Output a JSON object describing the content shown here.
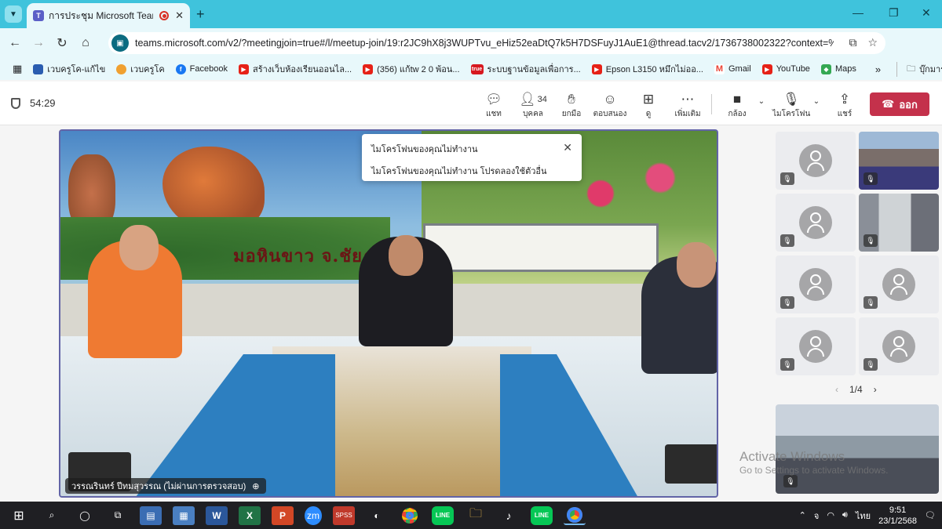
{
  "browser": {
    "tab_title": "การประชุม Microsoft Teams |",
    "tab_app_letter": "T",
    "url": "teams.microsoft.com/v2/?meetingjoin=true#/l/meetup-join/19:r2JC9hX8j3WUPTvu_eHiz52eaDtQ7k5H7DSFuyJ1AuE1@thread.tacv2/1736738002322?context=%7..."
  },
  "bookmarks": [
    {
      "label": "เวบครูโค-แก้ไข",
      "color": "#2a5db0",
      "icon": "bookmark-page-icon"
    },
    {
      "label": "เวบครูโค",
      "color": "#f0a030",
      "icon": "bookmark-globe-icon"
    },
    {
      "label": "Facebook",
      "color": "#1877f2",
      "icon": "facebook-icon"
    },
    {
      "label": "สร้างเว็บห้องเรียนออนไล...",
      "color": "#e62117",
      "icon": "youtube-icon"
    },
    {
      "label": "(356) แก้tw 2 0 พ้อน...",
      "color": "#e62117",
      "icon": "youtube-icon"
    },
    {
      "label": "ระบบฐานข้อมูลเพื่อการ...",
      "color": "#d71920",
      "icon": "true-icon"
    },
    {
      "label": "Epson L3150 หมึกไม่ออ...",
      "color": "#e62117",
      "icon": "youtube-icon"
    },
    {
      "label": "Gmail",
      "color": "#ea4335",
      "icon": "gmail-icon"
    },
    {
      "label": "YouTube",
      "color": "#e62117",
      "icon": "youtube-icon"
    },
    {
      "label": "Maps",
      "color": "#34a853",
      "icon": "maps-icon"
    }
  ],
  "bookmarks_more": "»",
  "bookmarks_all": "บุ๊กมาร์กทั้งหมด",
  "meeting": {
    "elapsed": "54:29",
    "chat_label": "แชท",
    "people_label": "บุคคล",
    "people_count": "34",
    "raise_label": "ยกมือ",
    "react_label": "ตอบสนอง",
    "view_label": "ดู",
    "more_label": "เพิ่มเติม",
    "camera_label": "กล้อง",
    "mic_label": "ไมโครโฟน",
    "share_label": "แชร์",
    "leave_label": "ออก"
  },
  "main_video": {
    "sign_text": "มอหินขาว  จ.ชัยภูมิ",
    "participant_name": "วรรณรินทร์ ปีทมสุวรรณ (ไม่ผ่านการตรวจสอบ)"
  },
  "toast": {
    "title": "ไมโครโฟนของคุณไม่ทำงาน",
    "body": "ไมโครโฟนของคุณไม่ทำงาน โปรดลองใช้ตัวอื่น"
  },
  "pager": {
    "text": "1/4"
  },
  "watermark": {
    "line1": "Activate Windows",
    "line2": "Go to Settings to activate Windows."
  },
  "taskbar": {
    "time": "9:51",
    "date": "23/1/2568",
    "lang": "ไทย",
    "tray_badge": "จ"
  }
}
